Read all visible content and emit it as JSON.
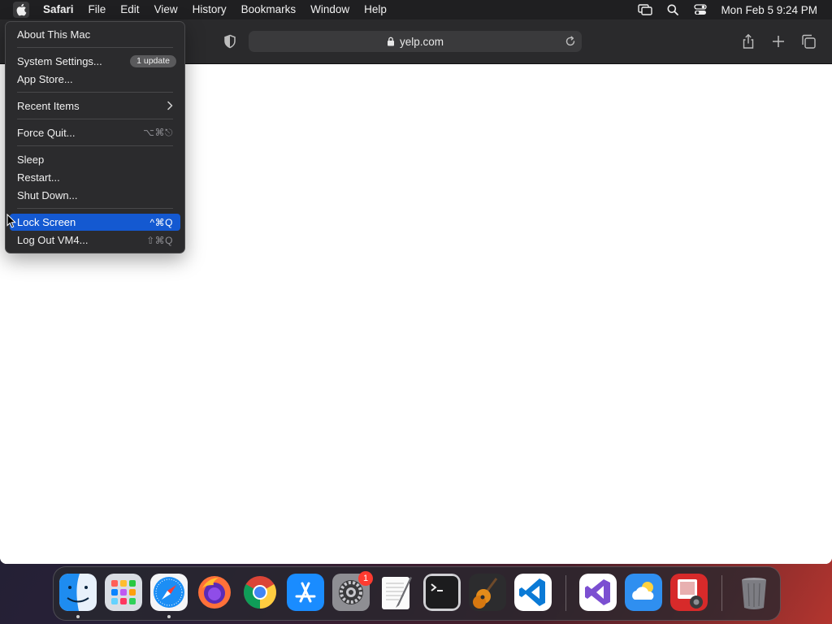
{
  "menubar": {
    "apple_icon": "apple-logo-icon",
    "menus": [
      "Safari",
      "File",
      "Edit",
      "View",
      "History",
      "Bookmarks",
      "Window",
      "Help"
    ],
    "status_icons": [
      "screen-mirroring-icon",
      "search-icon",
      "control-center-icon"
    ],
    "clock": "Mon Feb 5  9:24 PM"
  },
  "safari": {
    "url": "yelp.com",
    "toolbar_icons": [
      "privacy-shield-icon",
      "lock-icon",
      "reload-icon",
      "share-icon",
      "new-tab-icon",
      "tab-overview-icon"
    ]
  },
  "apple_menu": {
    "about": "About This Mac",
    "system_settings": "System Settings...",
    "update_badge": "1 update",
    "app_store": "App Store...",
    "recent_items": "Recent Items",
    "force_quit": "Force Quit...",
    "force_quit_shortcut": "⌥⌘⎋",
    "sleep": "Sleep",
    "restart": "Restart...",
    "shut_down": "Shut Down...",
    "lock_screen": "Lock Screen",
    "lock_screen_shortcut": "^⌘Q",
    "log_out": "Log Out VM4...",
    "log_out_shortcut": "⇧⌘Q",
    "highlighted_item": "Lock Screen"
  },
  "dock": {
    "apps": [
      "Finder",
      "Launchpad",
      "Safari",
      "Firefox",
      "Google Chrome",
      "App Store",
      "System Settings",
      "TextEdit",
      "Terminal",
      "GarageBand",
      "Visual Studio Code",
      "Visual Studio",
      "Weather",
      "Photo Booth",
      "Trash"
    ],
    "system_settings_badge": "1"
  },
  "colors": {
    "menu_highlight": "#1459d1",
    "menubar_bg": "#1f1f21",
    "badge_red": "#ff3b30"
  }
}
